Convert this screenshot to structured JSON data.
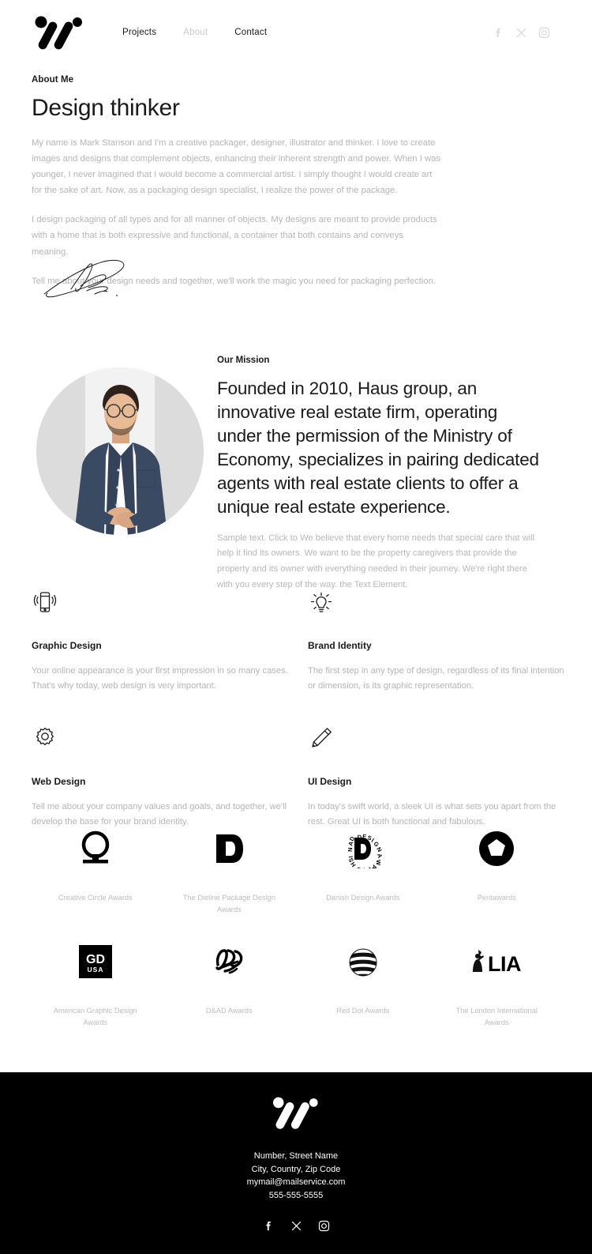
{
  "header": {
    "logo_name": "brand-logo",
    "nav": [
      {
        "label": "Projects",
        "state": "active"
      },
      {
        "label": "About",
        "state": "muted"
      },
      {
        "label": "Contact",
        "state": "active"
      }
    ],
    "social": [
      {
        "name": "facebook-icon",
        "label": "Facebook"
      },
      {
        "name": "x-twitter-icon",
        "label": "X"
      },
      {
        "name": "instagram-icon",
        "label": "Instagram"
      }
    ]
  },
  "about": {
    "eyebrow": "About Me",
    "title": "Design thinker",
    "paragraph1": "My name is Mark Stanson and I'm a creative packager, designer, illustrator and thinker. I love to create images and designs that complement objects, enhancing their inherent strength and power. When I was younger, I never imagined that I would become a commercial artist. I simply thought I would create art for the sake of art. Now, as a packaging design specialist, I realize the power of the package.",
    "paragraph2": "I design packaging of all types and for all manner of objects. My designs are meant to provide products with a home that is both expressive and functional, a container that both contains and conveys meaning.",
    "paragraph3": "Tell me about your design needs and together, we'll work the magic you need for packaging perfection.",
    "signature_name": "handwritten-signature"
  },
  "mission": {
    "portrait_alt": "Portrait of man with glasses in navy shirt",
    "eyebrow": "Our Mission",
    "headline": "Founded in 2010, Haus group, an innovative real estate firm, operating under the permission of the Ministry of Economy, specializes in pairing dedicated agents with real estate clients to offer a unique real estate experience.",
    "paragraph": "Sample text. Click to We believe that every home needs that special care that will help it find its owners. We want to be the property caregivers that provide the property and its owner with everything needed in their journey. We're right there with you every step of the way. the Text Element."
  },
  "services": [
    {
      "icon": "mobile-vibrate-icon",
      "title": "Graphic Design",
      "desc": "Your online appearance is your first impression in so many cases. That's why today, web design is very important."
    },
    {
      "icon": "lightbulb-icon",
      "title": "Brand Identity",
      "desc": "The first step in any type of design, regardless of its final intention or dimension, is its graphic representation."
    },
    {
      "icon": "gear-icon",
      "title": "Web Design",
      "desc": "Tell me about your company values and goals, and together, we'll develop the base for your brand identity."
    },
    {
      "icon": "pencil-icon",
      "title": "UI Design",
      "desc": "In today's swift world, a sleek UI is what sets you apart from the rest. Great UI is both functional and fabulous."
    }
  ],
  "awards": [
    {
      "logo": "creative-circle-logo",
      "name": "Creative Circle Awards"
    },
    {
      "logo": "dieline-d-logo",
      "name": "The Dieline Package Design Awards"
    },
    {
      "logo": "danish-design-logo",
      "name": "Danish Design Awards"
    },
    {
      "logo": "pentawards-logo",
      "name": "Pentawards"
    },
    {
      "logo": "gdusa-logo",
      "name": "American Graphic Design Awards"
    },
    {
      "logo": "dandad-logo",
      "name": "D&AD Awards"
    },
    {
      "logo": "reddot-logo",
      "name": "Red Dot Awards"
    },
    {
      "logo": "lia-logo",
      "name": "The London International Awards"
    }
  ],
  "footer": {
    "logo_name": "brand-logo-footer",
    "lines": [
      "Number, Street Name",
      "City, Country, Zip Code",
      "mymail@mailservice.com",
      "555-555-5555"
    ],
    "social": [
      {
        "name": "facebook-icon",
        "label": "Facebook"
      },
      {
        "name": "x-twitter-icon",
        "label": "X"
      },
      {
        "name": "instagram-icon",
        "label": "Instagram"
      }
    ]
  },
  "colors": {
    "background": "#ffffff",
    "ink": "#1a1a1a",
    "muted_text": "#b5b5b5",
    "footer_bg": "#000000",
    "header_social": "#d8d8d8"
  }
}
